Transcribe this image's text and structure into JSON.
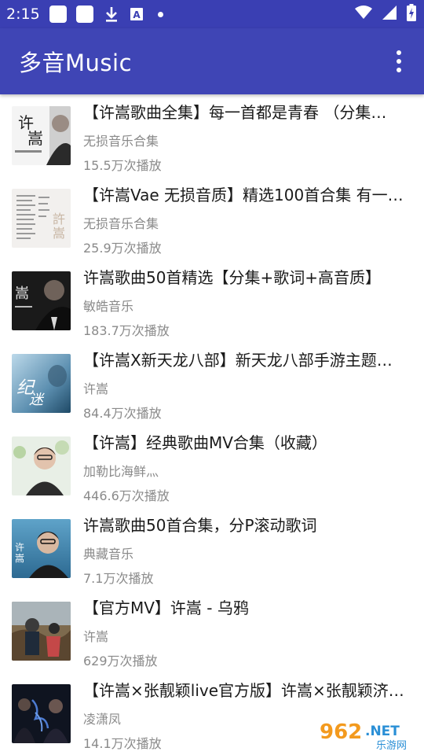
{
  "status_bar": {
    "time": "2:15"
  },
  "app_bar": {
    "title": "多音Music",
    "menu_icon": "more-vert-icon"
  },
  "playlists": [
    {
      "title": "【许嵩歌曲全集】每一首都是青春 （分集…",
      "author": "无损音乐合集",
      "plays": "15.5万次播放"
    },
    {
      "title": "【许嵩Vae 无损音质】精选100首合集 有一…",
      "author": "无损音乐合集",
      "plays": "25.9万次播放"
    },
    {
      "title": "许嵩歌曲50首精选【分集+歌词+高音质】",
      "author": "敏皓音乐",
      "plays": "183.7万次播放"
    },
    {
      "title": "【许嵩X新天龙八部】新天龙八部手游主题…",
      "author": "许嵩",
      "plays": "84.4万次播放"
    },
    {
      "title": "【许嵩】经典歌曲MV合集（收藏）",
      "author": "加勒比海鲜灬",
      "plays": "446.6万次播放"
    },
    {
      "title": "许嵩歌曲50首合集，分P滚动歌词",
      "author": "典藏音乐",
      "plays": "7.1万次播放"
    },
    {
      "title": "【官方MV】许嵩 - 乌鸦",
      "author": "许嵩",
      "plays": "629万次播放"
    },
    {
      "title": "【许嵩×张靓颖live官方版】许嵩×张靓颖济…",
      "author": "凌潇凤",
      "plays": "14.1万次播放"
    }
  ],
  "watermark": {
    "logo": "962",
    "net": ".NET",
    "sub": "乐游网"
  }
}
